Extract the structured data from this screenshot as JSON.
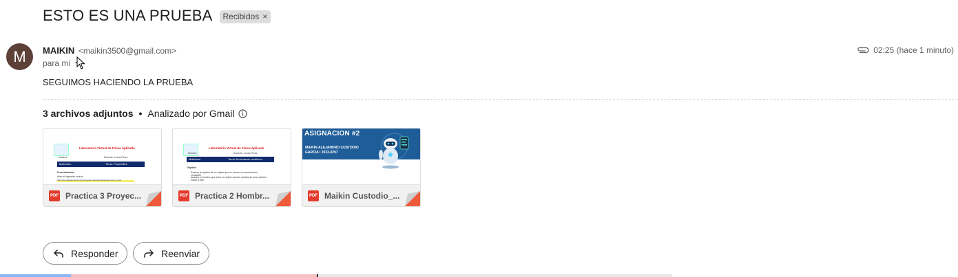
{
  "email": {
    "subject": "ESTO ES UNA PRUEBA",
    "label": "Recibidos",
    "label_remove": "×",
    "sender": {
      "avatar_letter": "M",
      "avatar_color": "#5d4037",
      "name": "MAIKIN",
      "email": "<maikin3500@gmail.com>",
      "recipient": "para mí"
    },
    "time": "02:25 (hace 1 minuto)",
    "body": "SEGUIMOS HACIENDO LA PRUEBA",
    "icons": [
      "attachment-icon",
      "info-icon",
      "reply-icon",
      "forward-icon"
    ]
  },
  "attachments": {
    "count_label": "3 archivos adjuntos",
    "separator": "•",
    "scan_label": "Analizado por Gmail",
    "items": [
      {
        "name": "Practica 3 Proyec...",
        "type": "PDF",
        "preview": {
          "title": "Laboratorio Virtual de Física Aplicada",
          "row_label": "Nombre:",
          "row_value": "Docente: Lucas Pérez",
          "bar_left": "Matrícula:",
          "bar_right": "Tema: Proyectiles",
          "section": "Procedimiento:",
          "line": "Abre el siguiente simula",
          "link": "https://phet.colorado.edu/sims/html/projectile-motion/latest/projectile-motion_es.html"
        }
      },
      {
        "name": "Practica 2 Hombr...",
        "type": "PDF",
        "preview": {
          "title": "Laboratorio Virtual de Física Aplicada",
          "row_label": "Nombre:",
          "row_value": "Docente: Lucas Pérez",
          "bar_left": "Matrícula:",
          "bar_right": "Tema: Movimiento rectilíneo",
          "section": "Objetivo",
          "bullet1": "Evaluar la rapidez de un objeto que se mueve con aceleración constante",
          "bullet2": "Analizar el cambio que sufre un objeto cuando cambia de una posición inicial a otra"
        }
      },
      {
        "name": "Maikin Custodio_...",
        "type": "PDF",
        "preview": {
          "title": "ASIGNACION #2",
          "line1": "MAIKIN ALEJANDRO CUSTODIO",
          "line2": "GARCIA / 2023-0297"
        }
      }
    ]
  },
  "actions": {
    "reply": "Responder",
    "forward": "Reenviar"
  }
}
